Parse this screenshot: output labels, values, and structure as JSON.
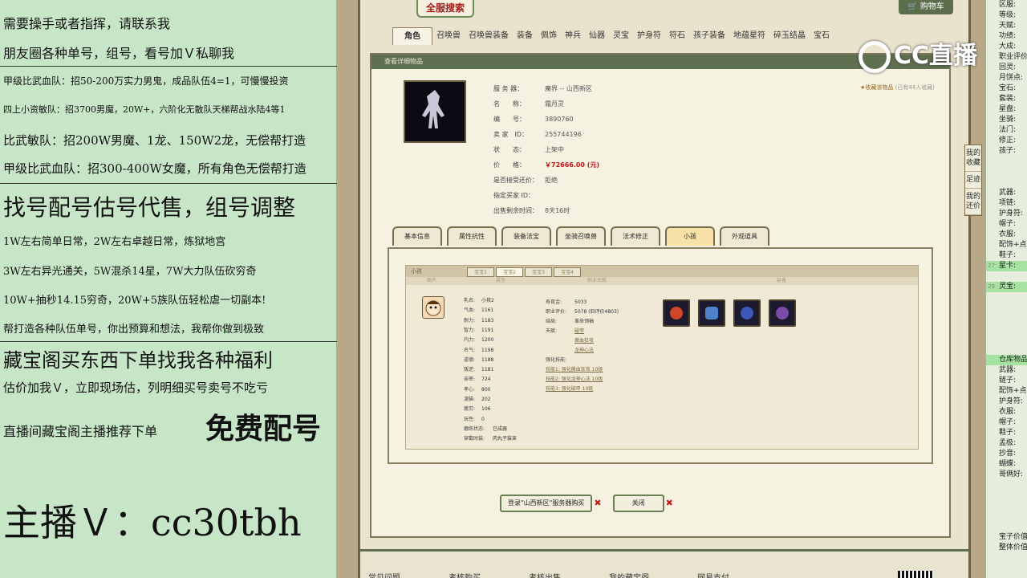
{
  "left_panel": {
    "lines": [
      "需要操手或者指挥，请联系我",
      "朋友圈各种单号，组号，看号加Ｖ私聊我",
      "甲级比武血队：招50-200万实力男鬼，成品队伍4=1，可慢慢投资",
      "四上小资敏队：招3700男魔，20W+，六阶化无散队天梯帮战水陆4等1",
      "比武敏队：招200W男魔、1龙、150W2龙，无偿帮打造",
      "甲级比武血队：招300-400W女魔，所有角色无偿帮打造",
      "找号配号估号代售，组号调整",
      "1W左右简单日常，2W左右卓越日常，炼狱地宫",
      "3W左右异光通关，5W混杀14星，7W大力队伍砍穷奇",
      "10W+抽秒14.15穷奇，20W+5族队伍轻松虐一切副本!",
      "帮打造各种队伍单号，你出预算和想法，我帮你做到极致",
      "藏宝阁买东西下单找我各种福利",
      "估价加我Ｖ，立即现场估，列明细买号卖号不吃亏",
      "直播间藏宝阁主播推荐下单",
      "免费配号",
      "主播Ｖ：cc30tbh"
    ]
  },
  "game": {
    "search_banner": "全服搜索",
    "cart_label": "购物车",
    "category_tabs": [
      "角色",
      "召唤兽",
      "召唤兽装备",
      "装备",
      "佩饰",
      "神兵",
      "仙器",
      "灵宝",
      "护身符",
      "符石",
      "孩子装备",
      "地蕴星符",
      "碎玉结晶",
      "宝石"
    ],
    "detail_title": "查看详细物品",
    "info": {
      "server_label": "服 务 器：",
      "server": "魔界 -- 山西新区",
      "name_label": "名　　称：",
      "name": "霜月灵",
      "id_label": "编　　号：",
      "id": "3890760",
      "seller_label": "卖 家　ID：",
      "seller": "255744196",
      "status_label": "状　　态：",
      "status": "上架中",
      "price_label": "价　　格：",
      "price": "￥72666.00 (元)",
      "counter_label": "是否接受还价：",
      "counter": "拒绝",
      "buyer_label": "指定买家 ID：",
      "buyer": "",
      "remaining_label": "出售剩余时间：",
      "remaining": "8天16时"
    },
    "favorite": {
      "label": "收藏该物品",
      "count": "(已有44人收藏)"
    },
    "sub_tabs": [
      "基本信息",
      "属性抗性",
      "装备法宝",
      "坐骑召唤兽",
      "法术修正",
      "小孩",
      "外观道具"
    ],
    "child_panel": {
      "header": "小孩",
      "bao_tabs": [
        "宝宝1",
        "宝宝2",
        "宝宝3",
        "宝宝4"
      ],
      "col_heads": [
        "图片",
        "属性",
        "职业天赋",
        "装备"
      ],
      "stats_left": [
        [
          "乳名:",
          "小孩2"
        ],
        [
          "气血:",
          "1161"
        ],
        [
          "耐力:",
          "1183"
        ],
        [
          "智力:",
          "1191"
        ],
        [
          "内力:",
          "1200"
        ],
        [
          "名气:",
          "1198"
        ],
        [
          "道德:",
          "1188"
        ],
        [
          "叛逆:",
          "1181"
        ],
        [
          "亲密:",
          "724"
        ],
        [
          "孝心:",
          "800"
        ],
        [
          "溜猫:",
          "202"
        ],
        [
          "疲劳:",
          "106"
        ],
        [
          "玩性:",
          "0"
        ],
        [
          "磨练状态:",
          "已成器"
        ],
        [
          "穿戴时装:",
          "肉丸子装束"
        ]
      ],
      "stats_right": {
        "life_label": "寿育金:",
        "life": "5033",
        "eval_label": "职业评价:",
        "eval": "5078 (旧评价4803)",
        "result_label": "结局:",
        "result": "革命领袖",
        "talent_label": "天赋:",
        "talents": [
          "破甲",
          "撕血狂攻",
          "龙神心法"
        ],
        "skill_label": "强化技能:",
        "skills": [
          "技能1: 强化撕血狂攻 10级",
          "技能2: 强化龙神心法 10级",
          "技能3: 强化破甲 10级"
        ]
      }
    },
    "actions": {
      "buy": "登录\"山西新区\"服务器购买",
      "close": "关闭"
    },
    "side_tabs": [
      "我的收藏",
      "足迹",
      "我的还价"
    ],
    "footer_links": [
      "常见问题",
      "考核购买",
      "考核出售",
      "我的藏宝阁",
      "网易支付"
    ]
  },
  "right_strip": {
    "rows": [
      {
        "n": "",
        "t": "区服:"
      },
      {
        "n": "",
        "t": "等级:"
      },
      {
        "n": "",
        "t": "天赋:"
      },
      {
        "n": "",
        "t": "功绩:"
      },
      {
        "n": "",
        "t": "大成:"
      },
      {
        "n": "",
        "t": "职业评价:"
      },
      {
        "n": "",
        "t": "回灵:"
      },
      {
        "n": "",
        "t": "月饼点:"
      },
      {
        "n": "",
        "t": "宝石:"
      },
      {
        "n": "",
        "t": "套装:"
      },
      {
        "n": "",
        "t": "星盘:"
      },
      {
        "n": "",
        "t": "坐骑:"
      },
      {
        "n": "",
        "t": "法门:"
      },
      {
        "n": "",
        "t": "修正:"
      },
      {
        "n": "",
        "t": "孩子:"
      },
      {
        "n": "",
        "t": ""
      },
      {
        "n": "",
        "t": ""
      },
      {
        "n": "",
        "t": ""
      },
      {
        "n": "",
        "t": "武器:"
      },
      {
        "n": "",
        "t": "项链:"
      },
      {
        "n": "",
        "t": "护身符:"
      },
      {
        "n": "",
        "t": "帽子:"
      },
      {
        "n": "",
        "t": "衣服:"
      },
      {
        "n": "",
        "t": "配饰+点"
      },
      {
        "n": "",
        "t": "鞋子:"
      },
      {
        "n": "27",
        "t": "星卡:",
        "hl": true
      },
      {
        "n": "",
        "t": ""
      },
      {
        "n": "29",
        "t": "灵宝:",
        "hl": true
      },
      {
        "n": "",
        "t": ""
      },
      {
        "n": "",
        "t": ""
      },
      {
        "n": "",
        "t": ""
      },
      {
        "n": "",
        "t": ""
      },
      {
        "n": "",
        "t": ""
      },
      {
        "n": "",
        "t": ""
      },
      {
        "n": "",
        "t": "仓库物品",
        "hl": true
      },
      {
        "n": "",
        "t": "武器:"
      },
      {
        "n": "",
        "t": "链子:"
      },
      {
        "n": "",
        "t": "配饰+点"
      },
      {
        "n": "",
        "t": "护身符:"
      },
      {
        "n": "",
        "t": "衣服:"
      },
      {
        "n": "",
        "t": "帽子:"
      },
      {
        "n": "",
        "t": "鞋子:"
      },
      {
        "n": "",
        "t": "孟极:"
      },
      {
        "n": "",
        "t": "抄音:"
      },
      {
        "n": "",
        "t": "蝴蝶:"
      },
      {
        "n": "",
        "t": "哥俩好:"
      },
      {
        "n": "",
        "t": ""
      },
      {
        "n": "",
        "t": ""
      },
      {
        "n": "",
        "t": ""
      },
      {
        "n": "",
        "t": ""
      },
      {
        "n": "",
        "t": ""
      },
      {
        "n": "",
        "t": "宝子价值"
      },
      {
        "n": "",
        "t": "整体价值"
      }
    ]
  },
  "watermark": "CC直播"
}
